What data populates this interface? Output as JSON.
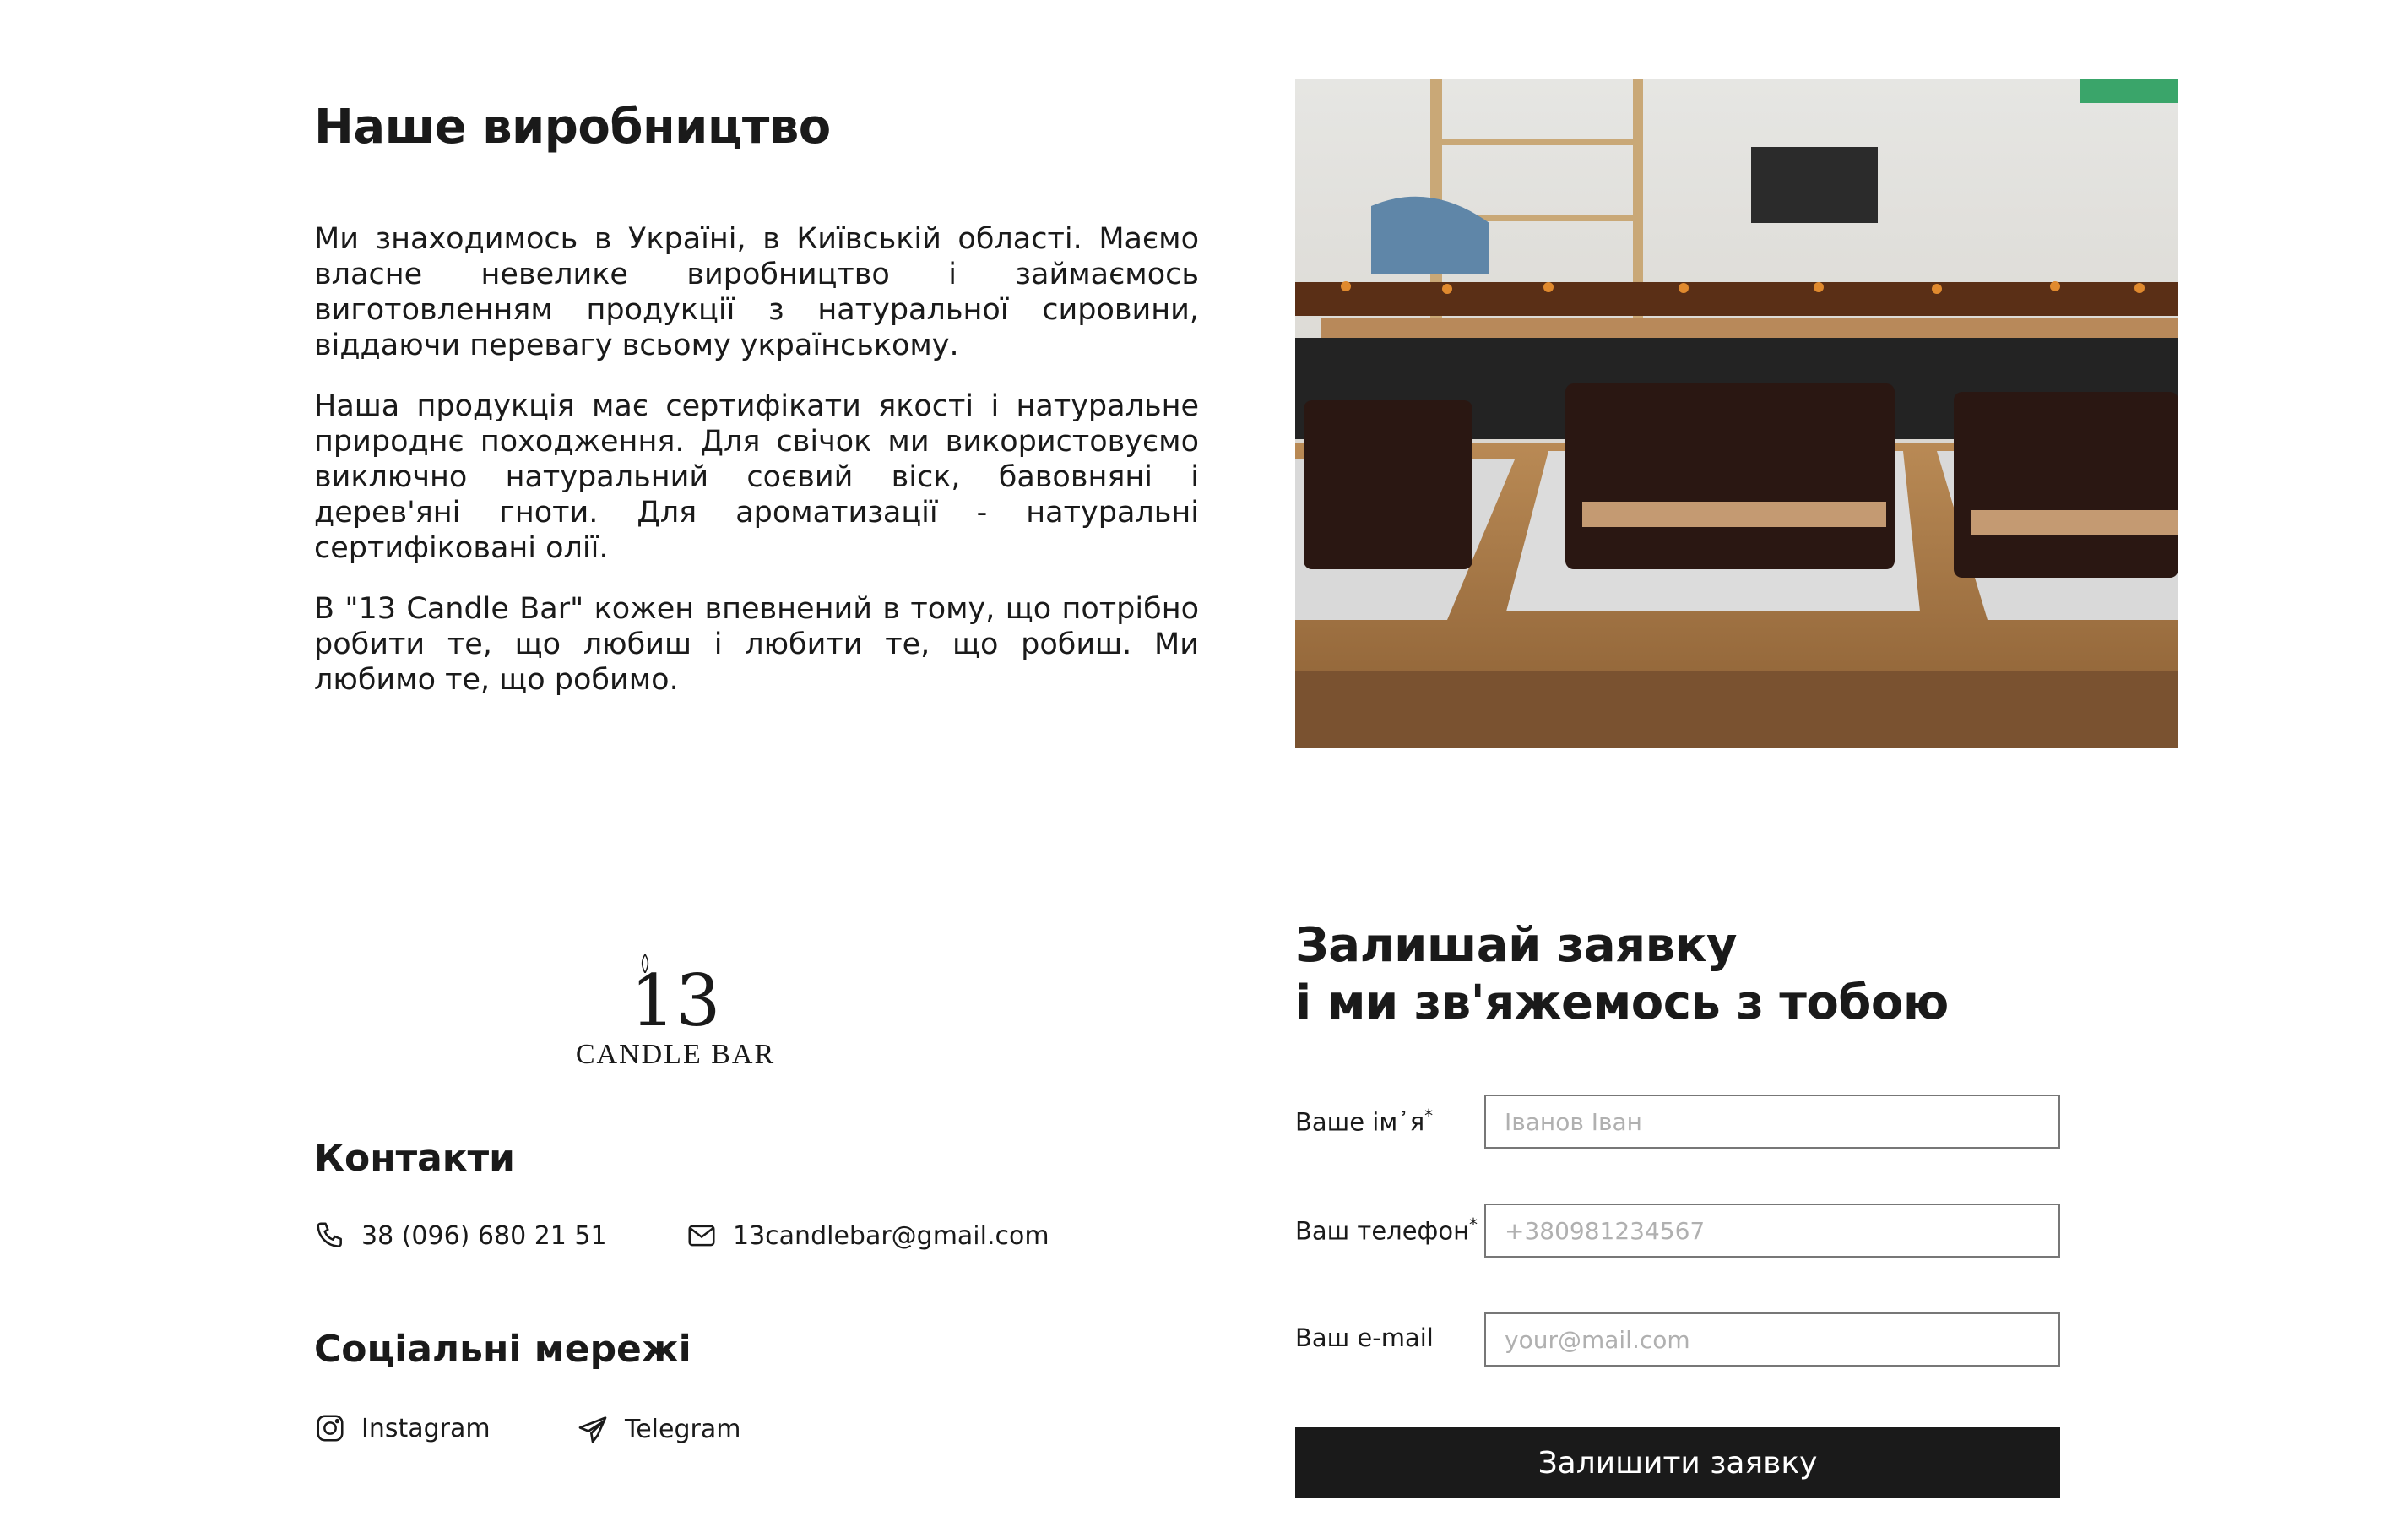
{
  "production": {
    "title": "Наше виробництво",
    "paragraphs": [
      "Ми знаходимось в Україні, в Київській області. Маємо власне невелике виробництво і займаємось виготовленням продукції з натуральної сировини, віддаючи перевагу всьому українському.",
      "Наша продукція має сертифікати якості і натуральне природнє походження. Для свічок ми використовуємо виключно натуральний соєвий віск, бавовняні і дерев'яні гноти. Для ароматизації - натуральні сертифіковані олії.",
      "В \"13 Candle Bar\" кожен впевнений в тому, що потрібно робити те, що любиш і любити те, що робиш. Ми любимо те, що робимо."
    ]
  },
  "logo": {
    "number": "13",
    "name": "CANDLE BAR"
  },
  "contacts": {
    "title": "Контакти",
    "phone": "38 (096) 680 21 51",
    "email": "13candlebar@gmail.com"
  },
  "social": {
    "title": "Соціальні мережі",
    "instagram": "Instagram",
    "telegram": "Telegram"
  },
  "form": {
    "title_line1": "Залишай заявку",
    "title_line2": "і ми зв'яжемось з тобою",
    "name_label": "Ваше ім᾽я",
    "name_placeholder": "Іванов Іван",
    "phone_label": "Ваш телефон",
    "phone_placeholder": "+380981234567",
    "email_label": "Ваш e-mail",
    "email_placeholder": "your@mail.com",
    "required_mark": "*",
    "submit_label": "Залишити заявку"
  },
  "colors": {
    "text": "#1a1a1a",
    "button_bg": "#1a1a1a",
    "button_text": "#ffffff"
  }
}
